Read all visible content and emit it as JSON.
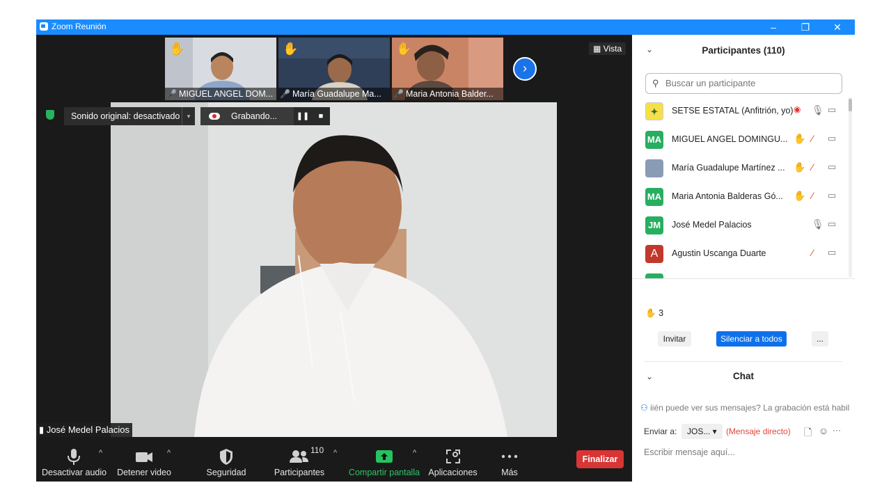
{
  "window": {
    "title": "Zoom Reunión",
    "minimize": "–",
    "restore": "❐",
    "close": "✕"
  },
  "thumbnails": [
    {
      "name": "MIGUEL ANGEL DOM...",
      "hand": "✋",
      "mic": "🎤"
    },
    {
      "name": "María Guadalupe Ma...",
      "hand": "✋",
      "mic": "🎤"
    },
    {
      "name": "Maria Antonia Balder...",
      "hand": "✋",
      "mic": "🎤"
    }
  ],
  "next_arrow": "›",
  "view_label": "Vista",
  "sound_label": "Sonido original: desactivado",
  "sound_caret": "▾",
  "recording": {
    "label": "Grabando...",
    "pause": "❚❚",
    "stop": "■"
  },
  "active_speaker": "José Medel Palacios",
  "toolbar": {
    "audio": "Desactivar audio",
    "video": "Detener video",
    "security": "Seguridad",
    "participants": "Participantes",
    "participants_count": "110",
    "share": "Compartir pantalla",
    "apps": "Aplicaciones",
    "more": "Más",
    "end": "Finalizar",
    "caret": "^"
  },
  "participants_panel": {
    "title": "Participantes (110)",
    "collapse": "⌄",
    "search_placeholder": "Buscar un participante",
    "rows": [
      {
        "initials": "",
        "name": "SETSE ESTATAL (Anfitrión, yo)",
        "hand": "",
        "muted": false,
        "color": "#f5e04a"
      },
      {
        "initials": "MA",
        "name": "MIGUEL ANGEL DOMINGU...",
        "hand": "✋",
        "muted": true,
        "color": "#27ae60"
      },
      {
        "initials": "",
        "name": "María Guadalupe Martínez ...",
        "hand": "✋",
        "muted": true,
        "color": "#8a9bb5"
      },
      {
        "initials": "MA",
        "name": "Maria Antonia Balderas Gó...",
        "hand": "✋",
        "muted": true,
        "color": "#27ae60"
      },
      {
        "initials": "JM",
        "name": "José Medel Palacios",
        "hand": "",
        "muted": false,
        "color": "#27ae60"
      },
      {
        "initials": "A",
        "name": "Agustin Uscanga Duarte",
        "hand": "",
        "muted": true,
        "color": "#c0392b"
      }
    ],
    "raised_hands_icon": "✋",
    "raised_hands": "3",
    "invite": "Invitar",
    "mute_all": "Silenciar a todos",
    "more": "..."
  },
  "chat": {
    "title": "Chat",
    "collapse": "⌄",
    "notice": "iién puede ver sus mensajes? La grabación está habilit",
    "send_to_label": "Enviar a:",
    "recipient": "JOS...",
    "direct": "(Mensaje directo)",
    "placeholder": "Escribir mensaje aquí...",
    "more": "···"
  }
}
